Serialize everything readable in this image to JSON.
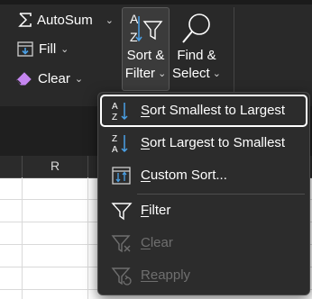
{
  "ribbon": {
    "autosum": {
      "label": "AutoSum",
      "icon": "sigma-icon"
    },
    "fill": {
      "label": "Fill",
      "icon": "fill-down-icon"
    },
    "clear": {
      "label": "Clear",
      "icon": "eraser-icon"
    },
    "sort_filter": {
      "line1": "Sort &",
      "line2": "Filter",
      "icon": "sort-filter-icon"
    },
    "find_select": {
      "line1": "Find &",
      "line2": "Select",
      "icon": "magnifier-icon"
    }
  },
  "sheet": {
    "column_label": "R"
  },
  "menu": {
    "items": [
      {
        "name": "sort-smallest-to-largest",
        "accel": "S",
        "rest": "ort Smallest to Largest",
        "icon": "sort-ascending-icon",
        "disabled": false
      },
      {
        "name": "sort-largest-to-smallest",
        "accel": "S",
        "rest": "ort Largest to Smallest",
        "icon": "sort-descending-icon",
        "disabled": false
      },
      {
        "name": "custom-sort",
        "accel": "C",
        "rest": "ustom Sort...",
        "icon": "custom-sort-icon",
        "disabled": false
      },
      {
        "name": "filter",
        "accel": "F",
        "rest": "ilter",
        "icon": "filter-icon",
        "disabled": false
      },
      {
        "name": "clear-filter",
        "accel": "C",
        "rest": "lear",
        "icon": "clear-filter-icon",
        "disabled": true
      },
      {
        "name": "reapply-filter",
        "accel": "Re",
        "rest": "apply",
        "icon": "reapply-filter-icon",
        "disabled": true
      }
    ]
  },
  "colors": {
    "ribbon_bg": "#292929",
    "menu_bg": "#2c2c2c",
    "text": "#ffffff",
    "disabled_text": "#6f6f6f",
    "accent_blue": "#4aa0e6",
    "accent_purple": "#c586f0"
  }
}
